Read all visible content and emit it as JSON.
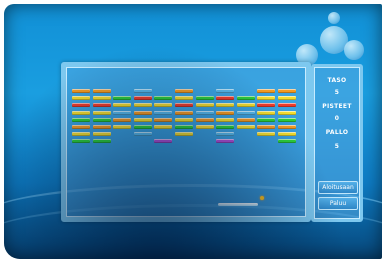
{
  "game": {
    "title": "",
    "stats": {
      "level_label": "TASO",
      "level_value": "5",
      "score_label": "PISTEET",
      "score_value": "0",
      "balls_label": "PALLO",
      "balls_value": "5"
    },
    "buttons": {
      "restart_label": "Aloitusaan",
      "back_label": "Paluu"
    },
    "colors": {
      "green": "#2ccd3a",
      "yellow": "#f2dd2f",
      "red": "#ef3b2a",
      "orange": "#f29a23",
      "blue": "#57b8e9",
      "purple": "#b04fd4",
      "ball": "#ffc21a"
    },
    "bricks": [
      [
        "orange",
        "orange",
        "",
        "blue",
        "",
        "orange",
        "",
        "blue",
        "",
        "orange",
        "orange"
      ],
      [
        "yellow",
        "yellow",
        "green",
        "red",
        "green",
        "yellow",
        "green",
        "red",
        "green",
        "yellow",
        "yellow"
      ],
      [
        "red",
        "red",
        "yellow",
        "yellow",
        "yellow",
        "red",
        "yellow",
        "yellow",
        "yellow",
        "red",
        "red"
      ],
      [
        "yellow",
        "yellow",
        "blue",
        "orange",
        "blue",
        "orange",
        "blue",
        "orange",
        "blue",
        "yellow",
        "yellow"
      ],
      [
        "green",
        "green",
        "orange",
        "yellow",
        "orange",
        "yellow",
        "orange",
        "yellow",
        "orange",
        "green",
        "green"
      ],
      [
        "orange",
        "orange",
        "yellow",
        "green",
        "yellow",
        "green",
        "yellow",
        "green",
        "yellow",
        "orange",
        "orange"
      ],
      [
        "yellow",
        "yellow",
        "",
        "blue",
        "",
        "yellow",
        "",
        "blue",
        "",
        "yellow",
        "yellow"
      ],
      [
        "green",
        "green",
        "",
        "",
        "purple",
        "",
        "",
        "purple",
        "",
        "",
        "green"
      ]
    ]
  }
}
